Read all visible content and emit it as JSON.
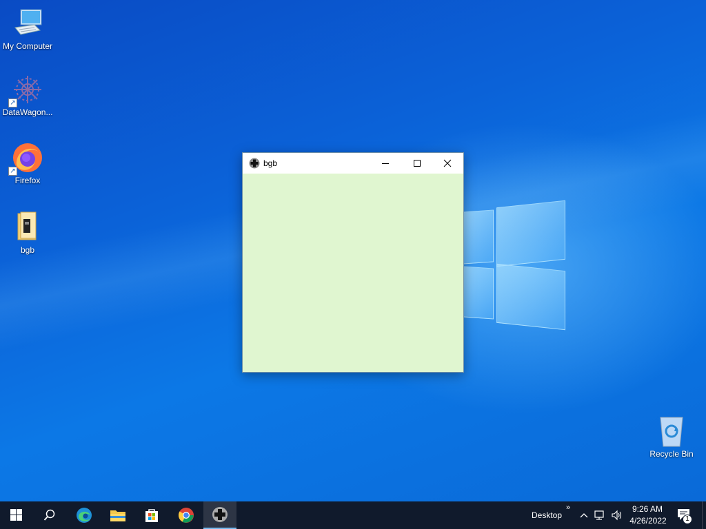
{
  "desktop": {
    "icons": [
      {
        "label": "My Computer",
        "icon": "computer-icon"
      },
      {
        "label": "DataWagon...",
        "icon": "datawagon-icon"
      },
      {
        "label": "Firefox",
        "icon": "firefox-icon"
      },
      {
        "label": "bgb",
        "icon": "folder-icon"
      },
      {
        "label": "Recycle Bin",
        "icon": "recycle-bin-icon"
      }
    ]
  },
  "window": {
    "title": "bgb",
    "icon": "dpad-icon",
    "background": "#e0f6d0"
  },
  "taskbar": {
    "apps": [
      "start-icon",
      "search-icon",
      "edge-icon",
      "file-explorer-icon",
      "store-icon",
      "chrome-icon",
      "bgb-icon"
    ],
    "desktop_label": "Desktop",
    "overflow_chevrons": "»",
    "time": "9:26 AM",
    "date": "4/26/2022",
    "notification_count": "1"
  },
  "colors": {
    "taskbar": "#101a2c",
    "accent": "#76b9ed"
  }
}
